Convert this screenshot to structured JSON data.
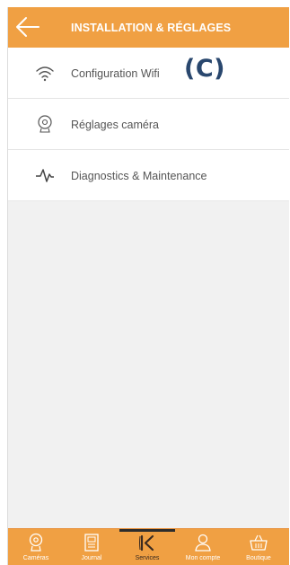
{
  "header": {
    "title": "INSTALLATION & RÉGLAGES",
    "back_icon": "arrow-left-icon",
    "color": "#f0a043"
  },
  "menu": [
    {
      "label": "Configuration Wifi",
      "icon": "wifi-icon"
    },
    {
      "label": "Réglages caméra",
      "icon": "camera-icon"
    },
    {
      "label": "Diagnostics & Maintenance",
      "icon": "pulse-icon"
    }
  ],
  "annotation": "(C)",
  "tabbar": {
    "active": "Services",
    "tabs": [
      {
        "label": "Caméras",
        "icon": "camera-icon"
      },
      {
        "label": "Journal",
        "icon": "journal-icon"
      },
      {
        "label": "Services",
        "icon": "k-logo-icon"
      },
      {
        "label": "Mon compte",
        "icon": "user-icon"
      },
      {
        "label": "Boutique",
        "icon": "basket-icon"
      }
    ]
  }
}
